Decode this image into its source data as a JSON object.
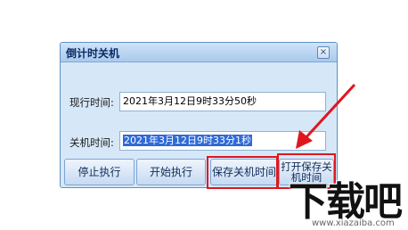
{
  "window": {
    "title": "倒计时关机",
    "close_label": "×"
  },
  "form": {
    "current_time_label": "现行时间:",
    "current_time_value": "2021年3月12日9时33分50秒",
    "shutdown_time_label": "关机时间:",
    "shutdown_time_value": "2021年3月12日9时33分1秒"
  },
  "buttons": {
    "stop": "停止执行",
    "start": "开始执行",
    "save": "保存关机时间",
    "open_line1": "打开保存关",
    "open_line2": "机时间"
  },
  "annotations": {
    "highlight_color": "#e0161e"
  },
  "watermark": {
    "logo_text": "下载吧",
    "url": "www.xiazaiba.com"
  }
}
